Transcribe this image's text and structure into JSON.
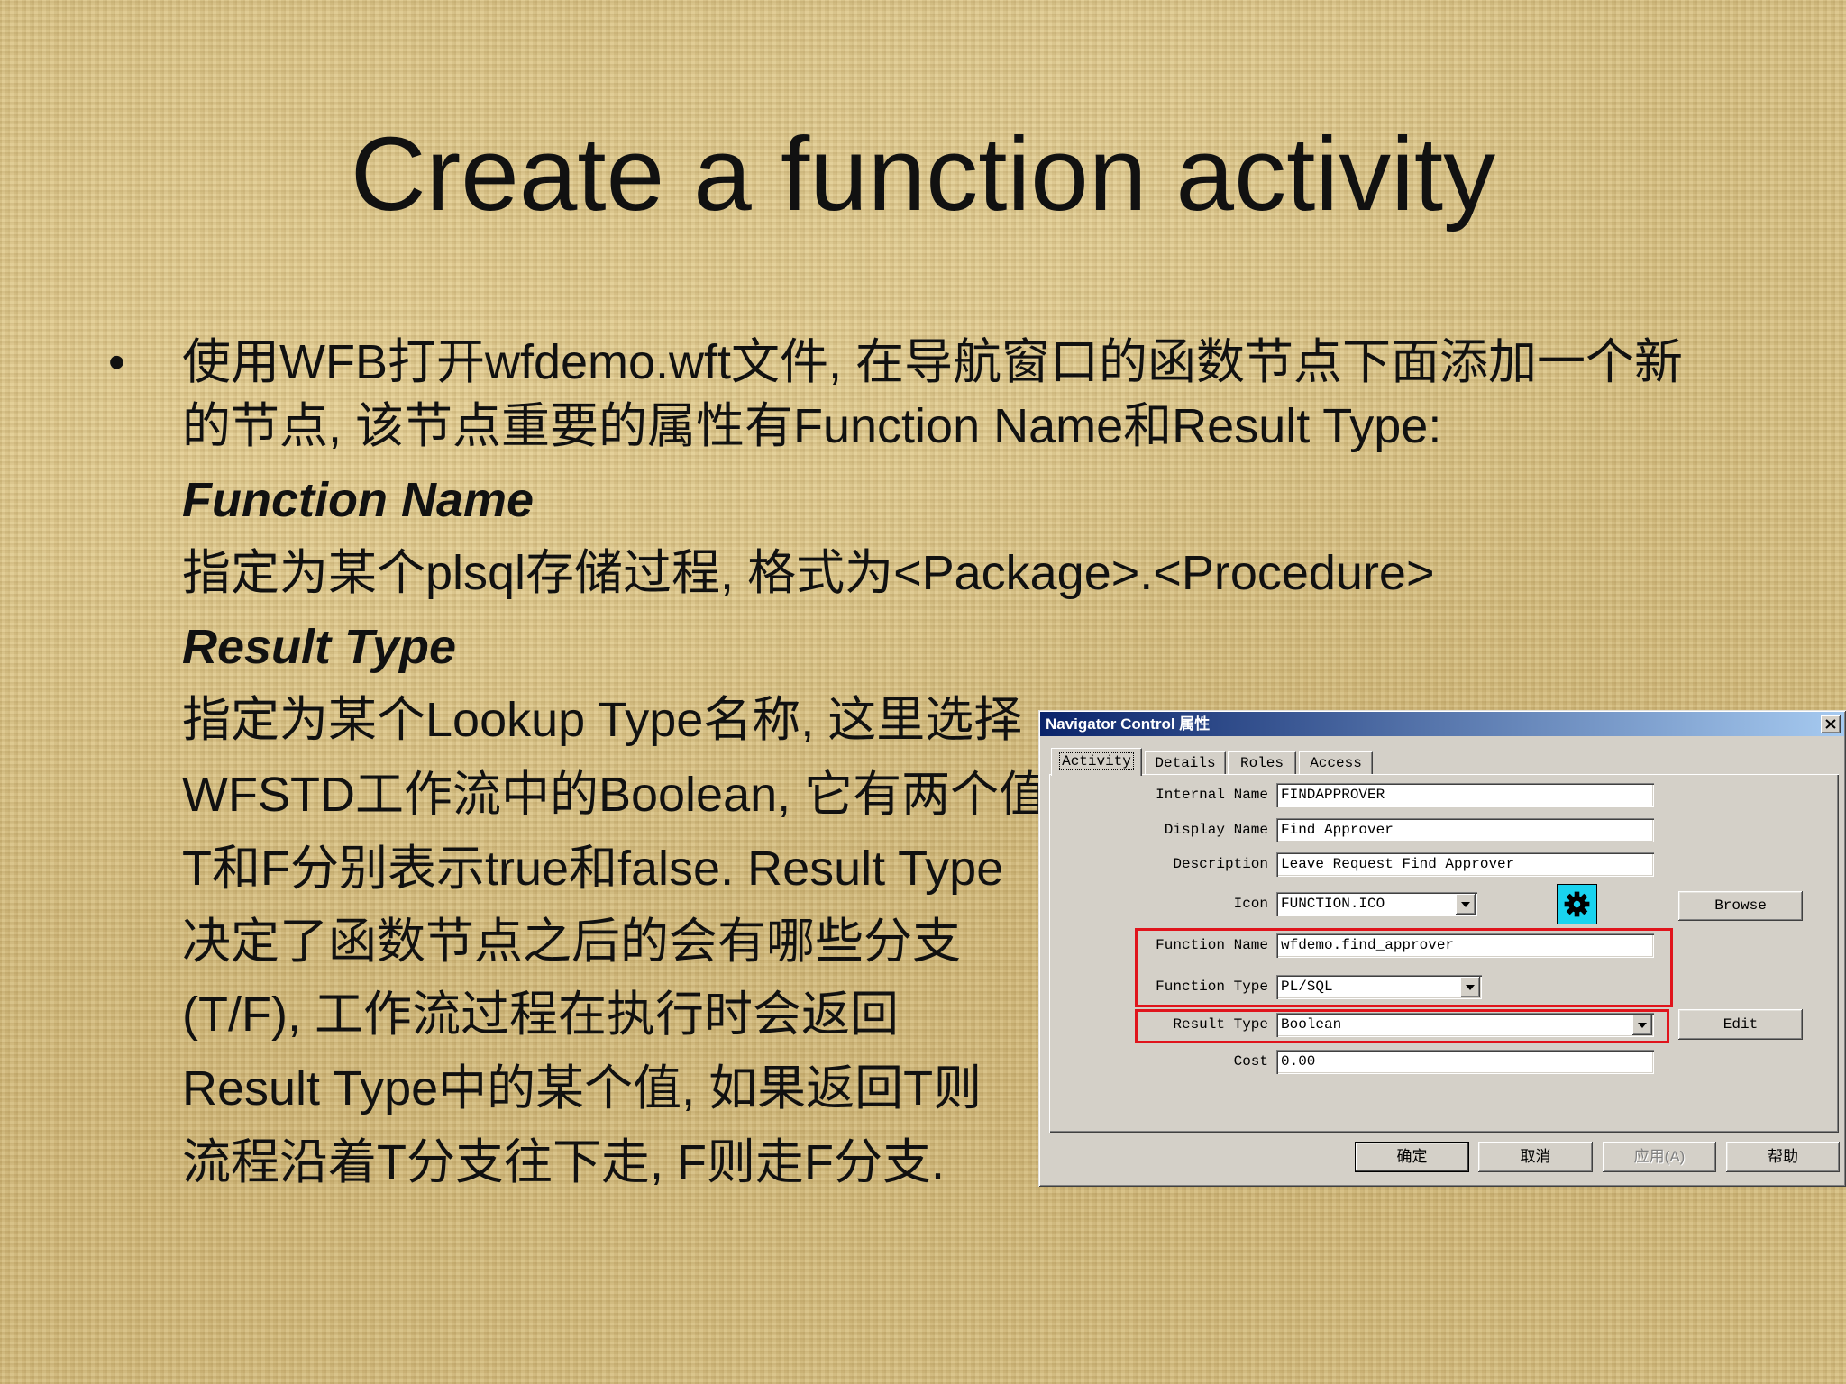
{
  "theme": {
    "background": "#d7c185",
    "text": "#111111",
    "highlight": "#e0141c",
    "titlebar_start": "#0a246a",
    "titlebar_end": "#a6caf0",
    "window_face": "#d4d0c8",
    "gear_background": "#19d3ef"
  },
  "slide": {
    "title": "Create a function activity",
    "bullet": "•",
    "intro": [
      "使用WFB打开wfdemo.wft文件, 在导航窗口的函数节点下面添加一个新",
      "的节点, 该节点重要的属性有Function Name和Result Type:"
    ],
    "function_name": {
      "heading": "Function Name",
      "text": "指定为某个plsql存储过程, 格式为<Package>.<Procedure>"
    },
    "result_type": {
      "heading": "Result Type",
      "lines": [
        "指定为某个Lookup Type名称, 这里选择",
        "WFSTD工作流中的Boolean, 它有两个值",
        "T和F分别表示true和false. Result Type",
        "决定了函数节点之后的会有哪些分支",
        "(T/F), 工作流过程在执行时会返回",
        "Result Type中的某个值, 如果返回T则",
        "流程沿着T分支往下走, F则走F分支."
      ]
    }
  },
  "dialog": {
    "title": "Navigator Control 属性",
    "close_icon": "close-icon",
    "tabs": [
      {
        "label": "Activity",
        "active": true
      },
      {
        "label": "Details",
        "active": false
      },
      {
        "label": "Roles",
        "active": false
      },
      {
        "label": "Access",
        "active": false
      }
    ],
    "fields": {
      "internal_name": {
        "label": "Internal Name",
        "value": "FINDAPPROVER"
      },
      "display_name": {
        "label": "Display Name",
        "value": "Find Approver"
      },
      "description": {
        "label": "Description",
        "value": "Leave Request Find Approver"
      },
      "icon": {
        "label": "Icon",
        "value": "FUNCTION.ICO",
        "preview_icon": "gear-icon"
      },
      "function_name": {
        "label": "Function Name",
        "value": "wfdemo.find_approver"
      },
      "function_type": {
        "label": "Function Type",
        "value": "PL/SQL"
      },
      "result_type": {
        "label": "Result Type",
        "value": "Boolean"
      },
      "cost": {
        "label": "Cost",
        "value": "0.00"
      }
    },
    "dropdown_icon": "chevron-down-icon",
    "buttons": {
      "browse": "Browse",
      "edit": "Edit",
      "ok": "确定",
      "cancel": "取消",
      "apply": "应用(A)",
      "help": "帮助"
    },
    "disabled_buttons": [
      "apply"
    ]
  }
}
